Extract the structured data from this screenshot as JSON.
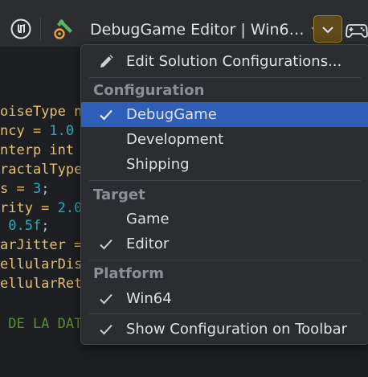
{
  "toolbar": {
    "config_selector_label": "DebugGame Editor | Win6…",
    "icons": [
      "unreal-engine-icon",
      "build-icon",
      "chevron-down-icon",
      "game-controller-icon"
    ]
  },
  "editor": {
    "lines": [
      {
        "parts": [
          {
            "t": "oiseType n",
            "c": "c-yellow"
          }
        ]
      },
      {
        "parts": [
          {
            "t": "ncy = ",
            "c": "c-yellow"
          },
          {
            "t": "1.0",
            "c": "c-num"
          }
        ]
      },
      {
        "parts": [
          {
            "t": "nterp int",
            "c": "c-yellow"
          }
        ]
      },
      {
        "parts": [
          {
            "t": "ractalType",
            "c": "c-yellow"
          }
        ]
      },
      {
        "parts": [
          {
            "t": "s = ",
            "c": "c-yellow"
          },
          {
            "t": "3",
            "c": "c-num"
          },
          {
            "t": ";",
            "c": "c-text"
          }
        ]
      },
      {
        "parts": [
          {
            "t": "rity = ",
            "c": "c-yellow"
          },
          {
            "t": "2.0",
            "c": "c-num"
          }
        ]
      },
      {
        "parts": [
          {
            "t": " ",
            "c": "c-text"
          },
          {
            "t": "0.5f",
            "c": "c-num"
          },
          {
            "t": ";",
            "c": "c-text"
          }
        ]
      },
      {
        "parts": [
          {
            "t": "arJitter =",
            "c": "c-yellow"
          }
        ]
      },
      {
        "parts": [
          {
            "t": "ellularDis",
            "c": "c-yellow"
          }
        ]
      },
      {
        "parts": [
          {
            "t": "ellularRet",
            "c": "c-yellow"
          }
        ]
      },
      {
        "parts": [
          {
            "t": "",
            "c": "c-text"
          }
        ]
      },
      {
        "parts": [
          {
            "t": " DE LA DAT",
            "c": "c-green"
          }
        ]
      }
    ]
  },
  "menu": {
    "edit_solution": "Edit Solution Configurations...",
    "configuration_header": "Configuration",
    "configurations": [
      {
        "label": "DebugGame",
        "checked": true,
        "selected": true
      },
      {
        "label": "Development",
        "checked": false,
        "selected": false
      },
      {
        "label": "Shipping",
        "checked": false,
        "selected": false
      }
    ],
    "target_header": "Target",
    "targets": [
      {
        "label": "Game",
        "checked": false
      },
      {
        "label": "Editor",
        "checked": true
      }
    ],
    "platform_header": "Platform",
    "platforms": [
      {
        "label": "Win64",
        "checked": true
      }
    ],
    "show_on_toolbar": {
      "label": "Show Configuration on Toolbar",
      "checked": true
    }
  },
  "colors": {
    "accent_selected": "#2f5eb8",
    "menu_bg": "#2b2d30",
    "header_text": "#8c8f96",
    "dropdown_button_border": "#a67f1f"
  }
}
